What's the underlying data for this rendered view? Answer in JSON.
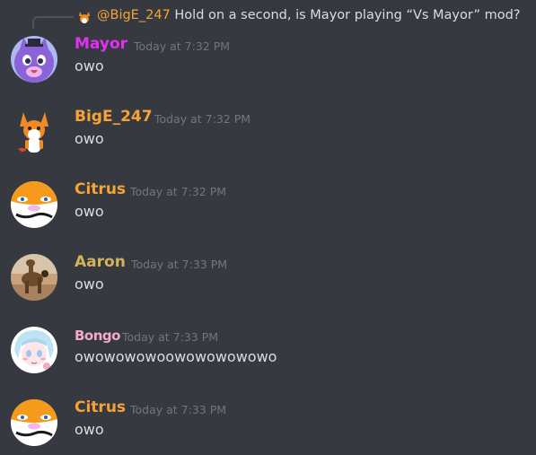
{
  "colors": {
    "background": "#36393f",
    "timestamp": "#72767d",
    "text": "#dcddde",
    "reply_line": "#4f545c"
  },
  "reply": {
    "author": "@BigE_247",
    "author_color": "#f6a336",
    "text": "Hold on a second, is Mayor playing “Vs Mayor” mod?"
  },
  "messages": [
    {
      "author": "Mayor",
      "author_color": "#e232f0",
      "timestamp": "Today at 7:32 PM",
      "content": "owo",
      "avatar": "purple-cat-avatar"
    },
    {
      "author": "BigE_247",
      "author_color": "#f6a336",
      "timestamp": "Today at 7:32 PM",
      "content": "owo",
      "avatar": "orange-fox-avatar"
    },
    {
      "author": "Citrus",
      "author_color": "#f6a336",
      "timestamp": "Today at 7:32 PM",
      "content": "owo",
      "avatar": "orange-face-avatar"
    },
    {
      "author": "Aaron",
      "author_color": "#d4b458",
      "timestamp": "Today at 7:33 PM",
      "content": "owo",
      "avatar": "camel-desert-avatar"
    },
    {
      "author": "Bongo",
      "author_color": "#f5a9c7",
      "timestamp": "Today at 7:33 PM",
      "content": "owowowowoowowowowowo",
      "avatar": "anime-girl-avatar"
    },
    {
      "author": "Citrus",
      "author_color": "#f6a336",
      "timestamp": "Today at 7:33 PM",
      "content": "owo",
      "avatar": "orange-face-avatar"
    }
  ]
}
